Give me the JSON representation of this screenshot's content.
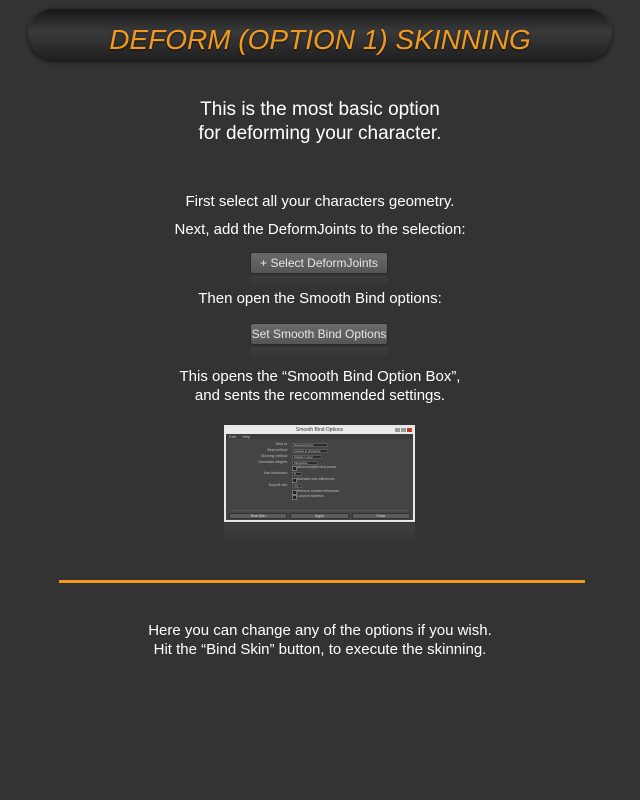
{
  "header": {
    "title": "DEFORM (OPTION 1) SKINNING"
  },
  "intro": {
    "line1": "This is the most basic option",
    "line2": "for deforming your character."
  },
  "steps": {
    "select_geometry": "First select all your characters geometry.",
    "add_joints": "Next, add the DeformJoints to the selection:",
    "open_options": "Then open the Smooth Bind options:",
    "opens_box_line1": "This opens the “Smooth Bind Option Box”,",
    "opens_box_line2": "and sents the recommended settings."
  },
  "buttons": {
    "select_deform_joints": "+ Select DeformJoints",
    "set_smooth_bind_options": "Set Smooth Bind Options"
  },
  "dialog": {
    "title": "Smooth Bind Options",
    "menus": [
      "Edit",
      "Help"
    ],
    "rows": [
      {
        "label": "Bind to:",
        "value": "Selected joints"
      },
      {
        "label": "Bind method:",
        "value": "Closest in hierarchy"
      },
      {
        "label": "Skinning method:",
        "value": "Classic Linear"
      },
      {
        "label": "Normalize weights:",
        "value": "Interactive"
      }
    ],
    "checkbox_multiple_bind_poses": "Allow multiple bind poses",
    "max_influences_label": "Max influences:",
    "max_influences_value": "5",
    "maintain_max_influences": "Maintain max influences",
    "dropoff_rate_label": "Dropoff rate:",
    "dropoff_rate_value": "4.0",
    "remove_unused_influences": "Remove unused influences",
    "colorize_skeleton": "Colorize skeleton",
    "buttons": [
      "Bind Skin",
      "Apply",
      "Close"
    ]
  },
  "outro": {
    "line1": "Here you can change any of the options if you wish.",
    "line2": "Hit the “Bind Skin” button, to execute the skinning."
  },
  "colors": {
    "accent": "#f39a1e",
    "background": "#333333"
  }
}
